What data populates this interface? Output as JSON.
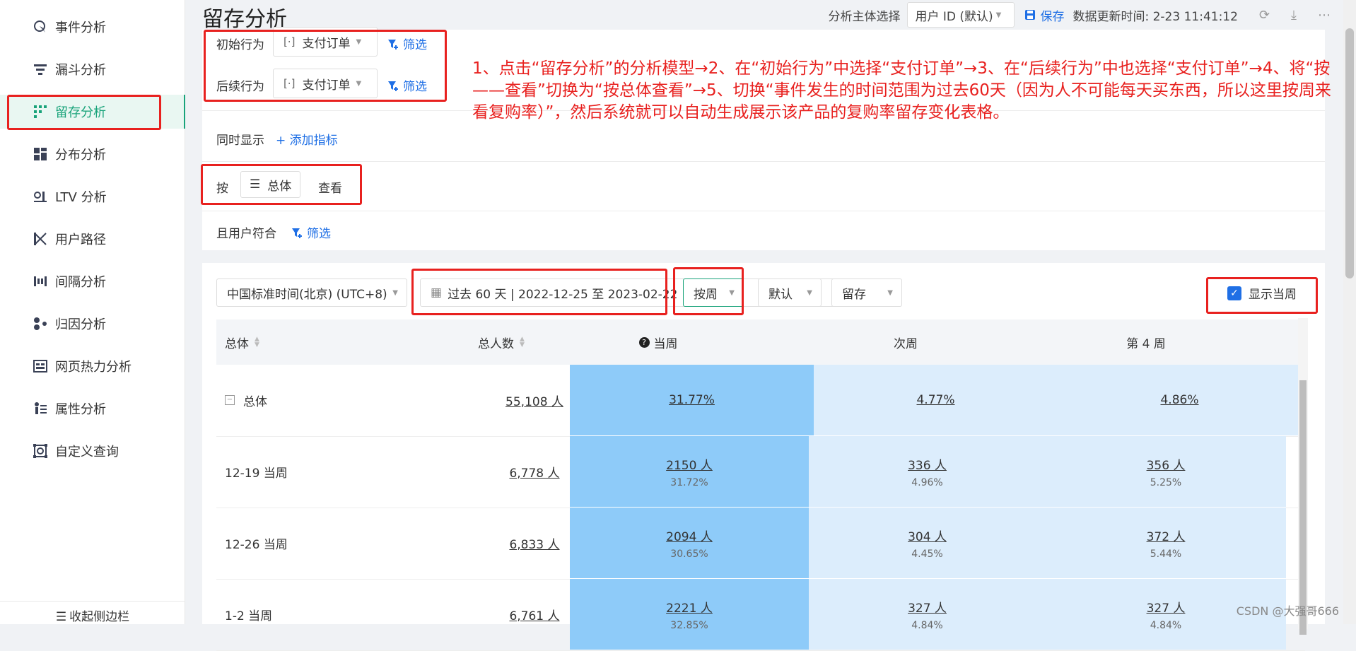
{
  "sidebar": {
    "items": [
      {
        "label": "事件分析",
        "icon": "cursor-icon"
      },
      {
        "label": "漏斗分析",
        "icon": "funnel-icon"
      },
      {
        "label": "留存分析",
        "icon": "retention-icon",
        "active": true
      },
      {
        "label": "分布分析",
        "icon": "distribution-icon"
      },
      {
        "label": "LTV 分析",
        "icon": "ltv-icon"
      },
      {
        "label": "用户路径",
        "icon": "path-icon"
      },
      {
        "label": "间隔分析",
        "icon": "interval-icon"
      },
      {
        "label": "归因分析",
        "icon": "attribution-icon"
      },
      {
        "label": "网页热力分析",
        "icon": "heatmap-icon"
      },
      {
        "label": "属性分析",
        "icon": "attribute-icon"
      },
      {
        "label": "自定义查询",
        "icon": "query-icon"
      }
    ],
    "collapse_label": "收起侧边栏"
  },
  "header": {
    "title": "留存分析",
    "subject_label": "分析主体选择",
    "subject_value": "用户 ID (默认)",
    "save_label": "保存",
    "update_time": "数据更新时间: 2-23 11:41:12"
  },
  "config": {
    "initial_label": "初始行为",
    "initial_event": "支付订单",
    "followup_label": "后续行为",
    "followup_event": "支付订单",
    "filter_label": "筛选",
    "show_also_label": "同时显示",
    "add_metric_label": "+ 添加指标",
    "by_prefix": "按",
    "by_value": "总体",
    "by_suffix": "查看",
    "user_match_label": "且用户符合",
    "user_filter_label": "筛选"
  },
  "annotation": "1、点击“留存分析”的分析模型→2、在“初始行为”中选择“支付订单”→3、在“后续行为”中也选择“支付订单”→4、将“按——查看”切换为“按总体查看”→5、切换“事件发生的时间范围为过去60天（因为人不可能每天买东西，所以这里按周来看复购率）”，然后系统就可以自动生成展示该产品的复购率留存变化表格。",
  "toolbar": {
    "timezone": "中国标准时间(北京) (UTC+8)",
    "date_range": "过去 60 天 | 2022-12-25 至 2023-02-22",
    "granularity": "按周",
    "mode": "默认",
    "type": "留存",
    "show_current_week": "显示当周"
  },
  "table": {
    "headers": [
      "总体",
      "总人数",
      "当周",
      "次周",
      "第 4 周"
    ],
    "rows": [
      {
        "label": "总体",
        "total": "55,108 人",
        "w0": "31.77%",
        "w0_pct": "",
        "w1": "4.77%",
        "w1_pct": "",
        "w4": "4.86%",
        "w4_pct": ""
      },
      {
        "label": "12-19 当周",
        "total": "6,778 人",
        "w0": "2150 人",
        "w0_pct": "31.72%",
        "w1": "336 人",
        "w1_pct": "4.96%",
        "w4": "356 人",
        "w4_pct": "5.25%"
      },
      {
        "label": "12-26 当周",
        "total": "6,833 人",
        "w0": "2094 人",
        "w0_pct": "30.65%",
        "w1": "304 人",
        "w1_pct": "4.45%",
        "w4": "372 人",
        "w4_pct": "5.44%"
      },
      {
        "label": "1-2 当周",
        "total": "6,761 人",
        "w0": "2221 人",
        "w0_pct": "32.85%",
        "w1": "327 人",
        "w1_pct": "4.84%",
        "w4": "327 人",
        "w4_pct": "4.84%"
      }
    ]
  },
  "watermark": "CSDN @大强哥666",
  "colors": {
    "accent": "#19a37a",
    "link": "#1f6fe5",
    "annotation": "#e8211f",
    "cell_dark": "#8ecbf9",
    "cell_light": "#dcedfc"
  }
}
